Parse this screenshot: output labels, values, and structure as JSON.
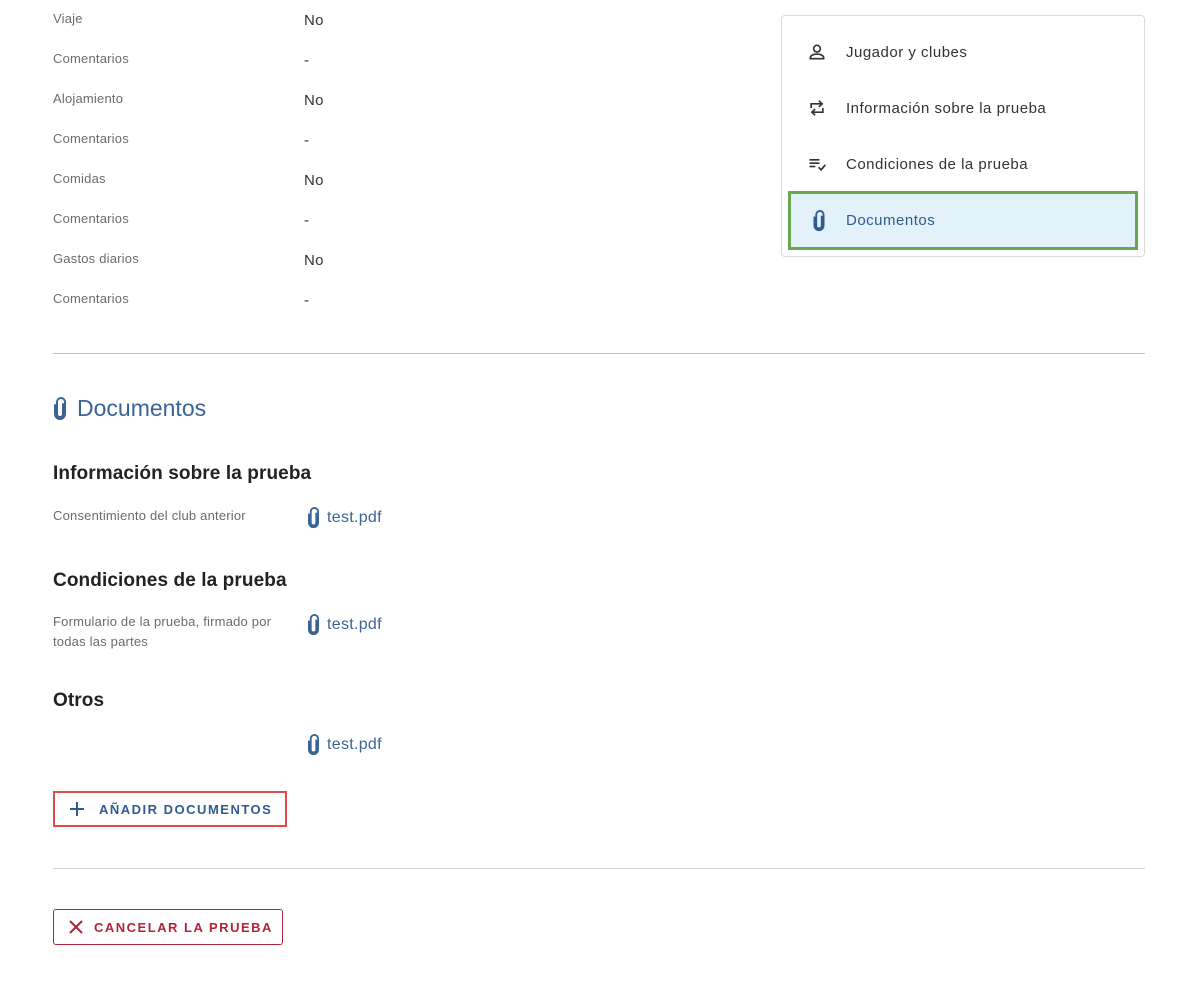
{
  "details": [
    {
      "label": "Viaje",
      "value": "No"
    },
    {
      "label": "Comentarios",
      "value": "-"
    },
    {
      "label": "Alojamiento",
      "value": "No"
    },
    {
      "label": "Comentarios",
      "value": "-"
    },
    {
      "label": "Comidas",
      "value": "No"
    },
    {
      "label": "Comentarios",
      "value": "-"
    },
    {
      "label": "Gastos diarios",
      "value": "No"
    },
    {
      "label": "Comentarios",
      "value": "-"
    }
  ],
  "nav": {
    "items": [
      {
        "label": "Jugador y clubes",
        "icon": "person-icon"
      },
      {
        "label": "Información sobre la prueba",
        "icon": "swap-icon"
      },
      {
        "label": "Condiciones de la prueba",
        "icon": "checklist-icon"
      },
      {
        "label": "Documentos",
        "icon": "paperclip-icon",
        "active": true
      }
    ]
  },
  "documents": {
    "title": "Documentos",
    "groups": [
      {
        "heading": "Información sobre la prueba",
        "label": "Consentimiento del club anterior",
        "file": "test.pdf"
      },
      {
        "heading": "Condiciones de la prueba",
        "label": "Formulario de la prueba, firmado por todas las partes",
        "file": "test.pdf"
      },
      {
        "heading": "Otros",
        "label": "",
        "file": "test.pdf"
      }
    ],
    "add_button": "AÑADIR DOCUMENTOS"
  },
  "cancel_button": "CANCELAR LA PRUEBA",
  "colors": {
    "accent": "#3a6496",
    "danger": "#b3243a",
    "active_bg": "#e3f1fa",
    "active_border": "#6aa84f",
    "highlight_border": "#e04c4c"
  }
}
